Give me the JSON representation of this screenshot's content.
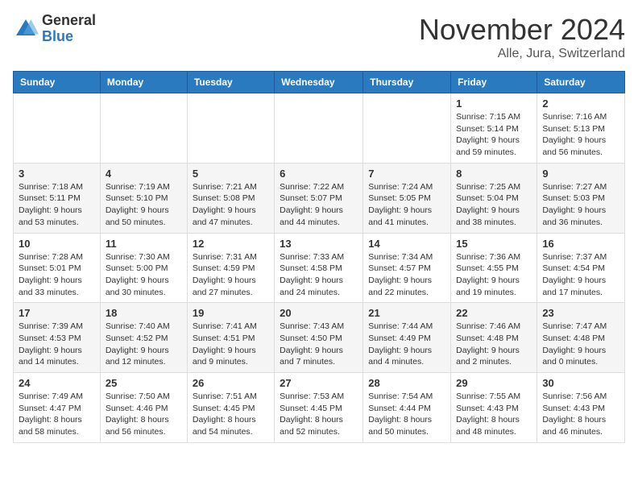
{
  "logo": {
    "general": "General",
    "blue": "Blue"
  },
  "title": {
    "month": "November 2024",
    "location": "Alle, Jura, Switzerland"
  },
  "header_days": [
    "Sunday",
    "Monday",
    "Tuesday",
    "Wednesday",
    "Thursday",
    "Friday",
    "Saturday"
  ],
  "weeks": [
    [
      {
        "day": "",
        "detail": ""
      },
      {
        "day": "",
        "detail": ""
      },
      {
        "day": "",
        "detail": ""
      },
      {
        "day": "",
        "detail": ""
      },
      {
        "day": "",
        "detail": ""
      },
      {
        "day": "1",
        "detail": "Sunrise: 7:15 AM\nSunset: 5:14 PM\nDaylight: 9 hours and 59 minutes."
      },
      {
        "day": "2",
        "detail": "Sunrise: 7:16 AM\nSunset: 5:13 PM\nDaylight: 9 hours and 56 minutes."
      }
    ],
    [
      {
        "day": "3",
        "detail": "Sunrise: 7:18 AM\nSunset: 5:11 PM\nDaylight: 9 hours and 53 minutes."
      },
      {
        "day": "4",
        "detail": "Sunrise: 7:19 AM\nSunset: 5:10 PM\nDaylight: 9 hours and 50 minutes."
      },
      {
        "day": "5",
        "detail": "Sunrise: 7:21 AM\nSunset: 5:08 PM\nDaylight: 9 hours and 47 minutes."
      },
      {
        "day": "6",
        "detail": "Sunrise: 7:22 AM\nSunset: 5:07 PM\nDaylight: 9 hours and 44 minutes."
      },
      {
        "day": "7",
        "detail": "Sunrise: 7:24 AM\nSunset: 5:05 PM\nDaylight: 9 hours and 41 minutes."
      },
      {
        "day": "8",
        "detail": "Sunrise: 7:25 AM\nSunset: 5:04 PM\nDaylight: 9 hours and 38 minutes."
      },
      {
        "day": "9",
        "detail": "Sunrise: 7:27 AM\nSunset: 5:03 PM\nDaylight: 9 hours and 36 minutes."
      }
    ],
    [
      {
        "day": "10",
        "detail": "Sunrise: 7:28 AM\nSunset: 5:01 PM\nDaylight: 9 hours and 33 minutes."
      },
      {
        "day": "11",
        "detail": "Sunrise: 7:30 AM\nSunset: 5:00 PM\nDaylight: 9 hours and 30 minutes."
      },
      {
        "day": "12",
        "detail": "Sunrise: 7:31 AM\nSunset: 4:59 PM\nDaylight: 9 hours and 27 minutes."
      },
      {
        "day": "13",
        "detail": "Sunrise: 7:33 AM\nSunset: 4:58 PM\nDaylight: 9 hours and 24 minutes."
      },
      {
        "day": "14",
        "detail": "Sunrise: 7:34 AM\nSunset: 4:57 PM\nDaylight: 9 hours and 22 minutes."
      },
      {
        "day": "15",
        "detail": "Sunrise: 7:36 AM\nSunset: 4:55 PM\nDaylight: 9 hours and 19 minutes."
      },
      {
        "day": "16",
        "detail": "Sunrise: 7:37 AM\nSunset: 4:54 PM\nDaylight: 9 hours and 17 minutes."
      }
    ],
    [
      {
        "day": "17",
        "detail": "Sunrise: 7:39 AM\nSunset: 4:53 PM\nDaylight: 9 hours and 14 minutes."
      },
      {
        "day": "18",
        "detail": "Sunrise: 7:40 AM\nSunset: 4:52 PM\nDaylight: 9 hours and 12 minutes."
      },
      {
        "day": "19",
        "detail": "Sunrise: 7:41 AM\nSunset: 4:51 PM\nDaylight: 9 hours and 9 minutes."
      },
      {
        "day": "20",
        "detail": "Sunrise: 7:43 AM\nSunset: 4:50 PM\nDaylight: 9 hours and 7 minutes."
      },
      {
        "day": "21",
        "detail": "Sunrise: 7:44 AM\nSunset: 4:49 PM\nDaylight: 9 hours and 4 minutes."
      },
      {
        "day": "22",
        "detail": "Sunrise: 7:46 AM\nSunset: 4:48 PM\nDaylight: 9 hours and 2 minutes."
      },
      {
        "day": "23",
        "detail": "Sunrise: 7:47 AM\nSunset: 4:48 PM\nDaylight: 9 hours and 0 minutes."
      }
    ],
    [
      {
        "day": "24",
        "detail": "Sunrise: 7:49 AM\nSunset: 4:47 PM\nDaylight: 8 hours and 58 minutes."
      },
      {
        "day": "25",
        "detail": "Sunrise: 7:50 AM\nSunset: 4:46 PM\nDaylight: 8 hours and 56 minutes."
      },
      {
        "day": "26",
        "detail": "Sunrise: 7:51 AM\nSunset: 4:45 PM\nDaylight: 8 hours and 54 minutes."
      },
      {
        "day": "27",
        "detail": "Sunrise: 7:53 AM\nSunset: 4:45 PM\nDaylight: 8 hours and 52 minutes."
      },
      {
        "day": "28",
        "detail": "Sunrise: 7:54 AM\nSunset: 4:44 PM\nDaylight: 8 hours and 50 minutes."
      },
      {
        "day": "29",
        "detail": "Sunrise: 7:55 AM\nSunset: 4:43 PM\nDaylight: 8 hours and 48 minutes."
      },
      {
        "day": "30",
        "detail": "Sunrise: 7:56 AM\nSunset: 4:43 PM\nDaylight: 8 hours and 46 minutes."
      }
    ]
  ]
}
